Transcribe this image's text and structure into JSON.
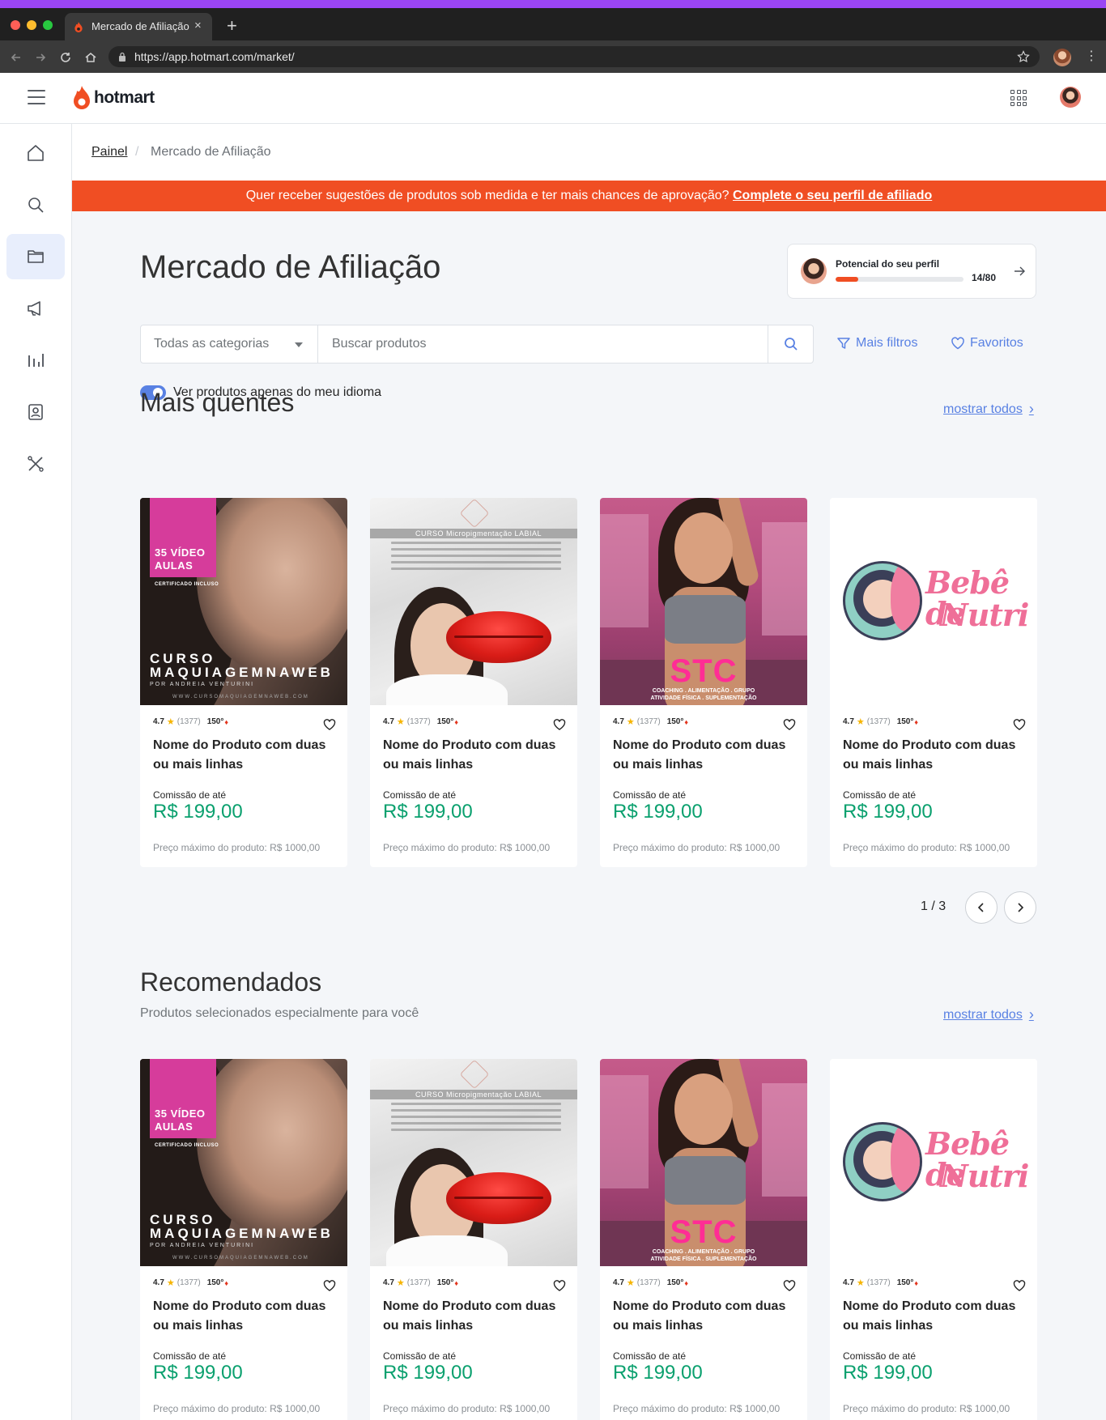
{
  "browser": {
    "tab_title": "Mercado de Afiliação",
    "url": "https://app.hotmart.com/market/",
    "new_tab_label": "+",
    "tab_close": "×",
    "menu": "⋮"
  },
  "header": {
    "logo_text": "hotmart"
  },
  "sidebar": {
    "items": [
      {
        "icon": "home-icon",
        "active": false
      },
      {
        "icon": "search-icon",
        "active": false
      },
      {
        "icon": "folder-icon",
        "active": true
      },
      {
        "icon": "megaphone-icon",
        "active": false
      },
      {
        "icon": "bar-chart-icon",
        "active": false
      },
      {
        "icon": "contact-icon",
        "active": false
      },
      {
        "icon": "tools-icon",
        "active": false
      }
    ]
  },
  "breadcrumb": {
    "root": "Painel",
    "separator": "/",
    "current": "Mercado de Afiliação"
  },
  "promo": {
    "text": "Quer receber sugestões de produtos sob medida e ter mais chances de aprovação?",
    "link": "Complete o seu perfil de afiliado"
  },
  "page_title": "Mercado de Afiliação",
  "profile_potential": {
    "title": "Potencial do seu perfil",
    "score": "14/80",
    "progress": 0.175
  },
  "filters": {
    "category": "Todas as categorias",
    "search_placeholder": "Buscar produtos",
    "more_filters": "Mais filtros",
    "favorites": "Favoritos",
    "language_toggle": "Ver produtos apenas do meu idioma",
    "language_toggle_on": true
  },
  "hot": {
    "title": "Mais quentes",
    "show_all": "mostrar todos",
    "pager": "1 / 3"
  },
  "recommended": {
    "title": "Recomendados",
    "subtitle": "Produtos selecionados especialmente para você",
    "show_all": "mostrar todos"
  },
  "products": [
    {
      "rating": "4.7",
      "reviews": "(1377)",
      "temperature": "150°",
      "name": "Nome do Produto com duas ou mais linhas",
      "commission_label": "Comissão de até",
      "commission": "R$ 199,00",
      "max_price": "Preço máximo do produto: R$ 1000,00",
      "image": {
        "badge": "35 VÍDEO AULAS",
        "badge_sub": "CERTIFICADO INCLUSO",
        "brand": "CURSO MAQUIAGEMNAWEB",
        "author": "POR ANDREIA VENTURINI",
        "site": "WWW.CURSOMAQUIAGEMNAWEB.COM"
      }
    },
    {
      "rating": "4.7",
      "reviews": "(1377)",
      "temperature": "150°",
      "name": "Nome do Produto com duas ou mais linhas",
      "commission_label": "Comissão de até",
      "commission": "R$ 199,00",
      "max_price": "Preço máximo do produto: R$ 1000,00",
      "image": {
        "bar": "CURSO Micropigmentação LABIAL"
      }
    },
    {
      "rating": "4.7",
      "reviews": "(1377)",
      "temperature": "150°",
      "name": "Nome do Produto com duas ou mais linhas",
      "commission_label": "Comissão de até",
      "commission": "R$ 199,00",
      "max_price": "Preço máximo do produto: R$ 1000,00",
      "image": {
        "brand": "STC",
        "line1": "COACHING . ALIMENTAÇÃO . GRUPO",
        "line2": "ATIVIDADE FÍSICA . SUPLEMENTAÇÃO"
      }
    },
    {
      "rating": "4.7",
      "reviews": "(1377)",
      "temperature": "150°",
      "name": "Nome do Produto com duas ou mais linhas",
      "commission_label": "Comissão de até",
      "commission": "R$ 199,00",
      "max_price": "Preço máximo do produto: R$ 1000,00",
      "image": {
        "word1": "Bebê de",
        "word2": "Nutri"
      }
    }
  ]
}
